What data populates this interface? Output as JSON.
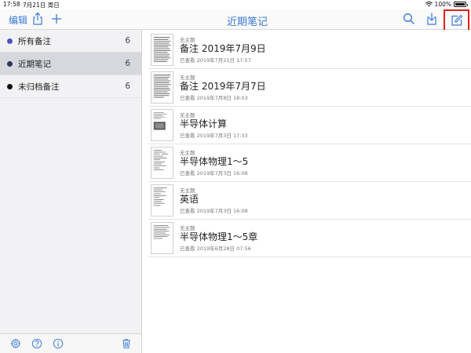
{
  "status_bar": {
    "time": "17:58",
    "date": "7月21日 周日",
    "battery": "100%"
  },
  "nav": {
    "edit_label": "编辑",
    "title": "近期笔记",
    "accent_color": "#3a79d6",
    "highlight_color": "#e0201a"
  },
  "sidebar": {
    "items": [
      {
        "label": "所有备注",
        "count": "6",
        "dot_color": "#4a55c2"
      },
      {
        "label": "近期笔记",
        "count": "6",
        "dot_color": "#2b3466"
      },
      {
        "label": "未归档备注",
        "count": "6",
        "dot_color": "#111111"
      }
    ],
    "toolbar_icons": [
      "gear-icon",
      "help-icon",
      "info-icon",
      "trash-icon"
    ]
  },
  "notes": [
    {
      "subject": "无主题",
      "title": "备注 2019年7月9日",
      "meta": "已查看 2019年7月21日 17:57",
      "thumb": "grid-dense"
    },
    {
      "subject": "无主题",
      "title": "备注 2019年7月7日",
      "meta": "已查看 2019年7月8日 18:03",
      "thumb": "grid-dense"
    },
    {
      "subject": "无主题",
      "title": "半导体计算",
      "meta": "已查看 2019年7月3日 17:33",
      "thumb": "photo"
    },
    {
      "subject": "无主题",
      "title": "半导体物理1～5",
      "meta": "已查看 2019年7月3日 16:08",
      "thumb": "text-sparse"
    },
    {
      "subject": "无主题",
      "title": "英语",
      "meta": "已查看 2019年7月3日 16:08",
      "thumb": "text-sparse"
    },
    {
      "subject": "无主题",
      "title": "半导体物理1～5章",
      "meta": "已查看 2019年6月28日 07:56",
      "thumb": "text-lines"
    }
  ]
}
